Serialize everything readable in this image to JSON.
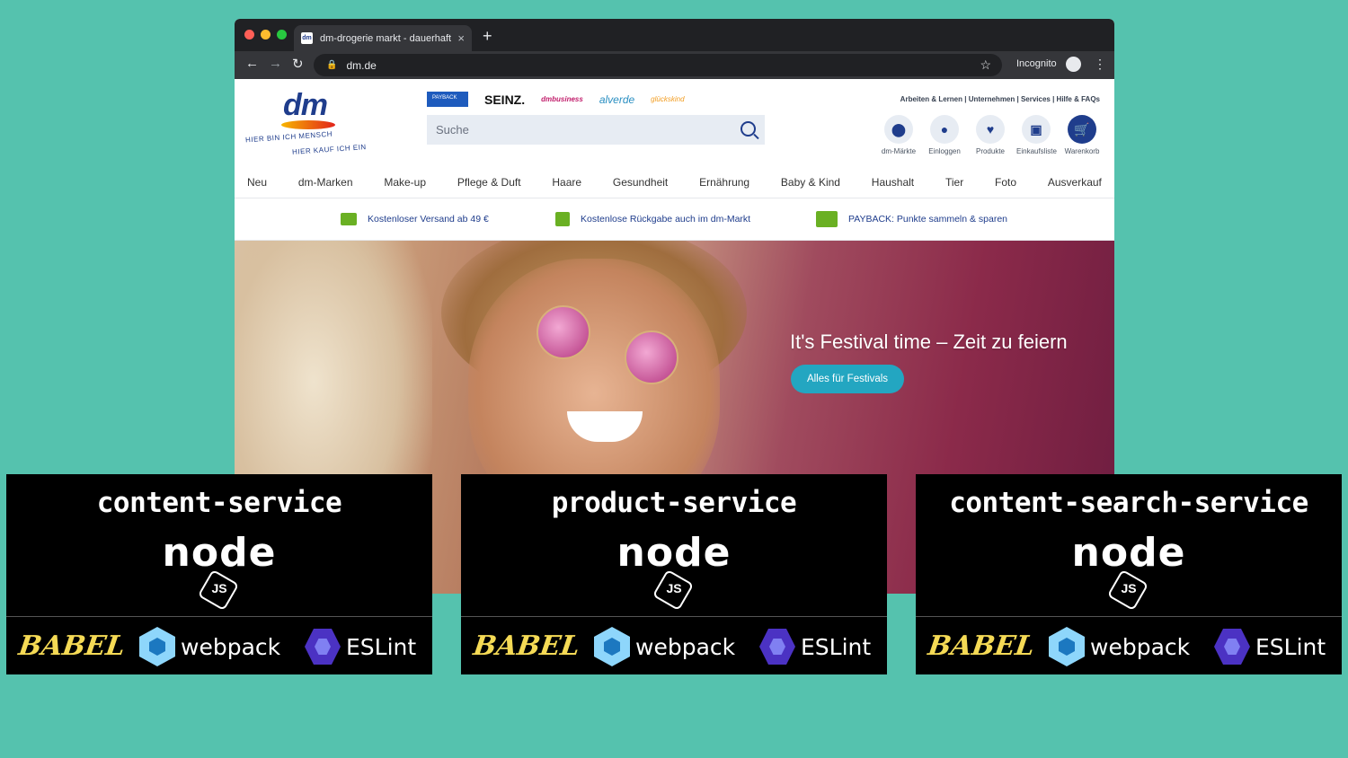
{
  "browser": {
    "tab_title": "dm-drogerie markt - dauerhaft",
    "tab_favicon": "dm",
    "new_tab_icon": "+",
    "url": "dm.de",
    "incognito_label": "Incognito"
  },
  "site": {
    "logo": {
      "word": "dm",
      "tagline_1": "HIER BIN ICH MENSCH",
      "tagline_2": "HIER KAUF ICH EIN"
    },
    "brands": [
      "PAYBACK",
      "SEINZ.",
      "dmbusiness",
      "alverde",
      "glückskind"
    ],
    "search_placeholder": "Suche",
    "top_links": "Arbeiten & Lernen | Unternehmen | Services | Hilfe & FAQs",
    "icons": [
      {
        "label": "dm-Märkte",
        "icon": "location-pin-icon"
      },
      {
        "label": "Einloggen",
        "icon": "user-icon"
      },
      {
        "label": "Produkte",
        "icon": "heart-icon"
      },
      {
        "label": "Einkaufsliste",
        "icon": "clipboard-icon"
      },
      {
        "label": "Warenkorb",
        "icon": "cart-icon"
      }
    ],
    "nav": [
      "Neu",
      "dm-Marken",
      "Make-up",
      "Pflege & Duft",
      "Haare",
      "Gesundheit",
      "Ernährung",
      "Baby & Kind",
      "Haushalt",
      "Tier",
      "Foto",
      "Ausverkauf"
    ],
    "usp": [
      {
        "text": "Kostenloser Versand ab 49 €",
        "color": "#6ab023"
      },
      {
        "text": "Kostenlose Rückgabe auch im dm-Markt",
        "color": "#6ab023"
      },
      {
        "text": "PAYBACK: Punkte sammeln & sparen",
        "color": "#6ab023"
      }
    ],
    "hero": {
      "title": "It's Festival time – Zeit zu feiern",
      "button": "Alles für Festivals"
    }
  },
  "cards": [
    {
      "title": "content-service",
      "runtime": "node",
      "tools": [
        "BABEL",
        "webpack",
        "ESLint"
      ]
    },
    {
      "title": "product-service",
      "runtime": "node",
      "tools": [
        "BABEL",
        "webpack",
        "ESLint"
      ]
    },
    {
      "title": "content-search-service",
      "runtime": "node",
      "tools": [
        "BABEL",
        "webpack",
        "ESLint"
      ]
    }
  ],
  "colors": {
    "background": "#55c2ae",
    "dm_blue": "#1f3d8c",
    "hero_button": "#23a6c1",
    "babel": "#f5da55",
    "eslint": "#4b32c3",
    "webpack": "#8ed6fb"
  }
}
